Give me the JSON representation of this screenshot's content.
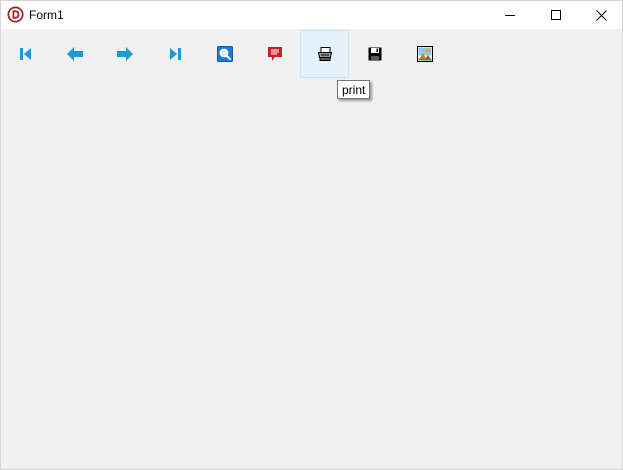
{
  "window": {
    "title": "Form1",
    "app_icon": "delphi-logo-icon"
  },
  "toolbar": {
    "buttons": [
      {
        "name": "first",
        "icon": "first-record-icon"
      },
      {
        "name": "prior",
        "icon": "prior-record-icon"
      },
      {
        "name": "next",
        "icon": "next-record-icon"
      },
      {
        "name": "last",
        "icon": "last-record-icon"
      },
      {
        "name": "search",
        "icon": "magnifier-icon"
      },
      {
        "name": "comment",
        "icon": "speech-bubble-icon"
      },
      {
        "name": "print",
        "icon": "printer-icon",
        "hovered": true
      },
      {
        "name": "save",
        "icon": "floppy-disk-icon"
      },
      {
        "name": "image",
        "icon": "picture-icon"
      }
    ]
  },
  "tooltip": {
    "text": "print"
  },
  "colors": {
    "background": "#f0f0f0",
    "nav_arrow": "#1e9ad6",
    "comment": "#c8202e",
    "hover_fill": "#e5f1fb"
  }
}
